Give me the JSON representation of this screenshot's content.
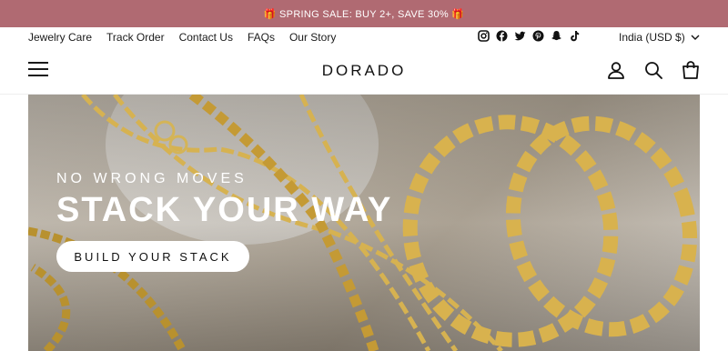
{
  "announcement": {
    "text": "🎁 SPRING SALE: BUY 2+, SAVE 30% 🎁"
  },
  "utility_nav": {
    "links": [
      "Jewelry Care",
      "Track Order",
      "Contact Us",
      "FAQs",
      "Our Story"
    ],
    "social_icons": [
      "instagram-icon",
      "facebook-icon",
      "twitter-icon",
      "pinterest-icon",
      "snapchat-icon",
      "tiktok-icon"
    ],
    "currency": "India (USD $)"
  },
  "header": {
    "logo": "DORADO",
    "icons": [
      "menu-icon",
      "account-icon",
      "search-icon",
      "cart-icon"
    ]
  },
  "hero": {
    "eyebrow": "NO WRONG MOVES",
    "headline": "STACK YOUR WAY",
    "cta_label": "BUILD YOUR STACK"
  },
  "colors": {
    "announcement_bg": "#b06a72",
    "text": "#1a1a1a",
    "gold": "#c9a447"
  }
}
